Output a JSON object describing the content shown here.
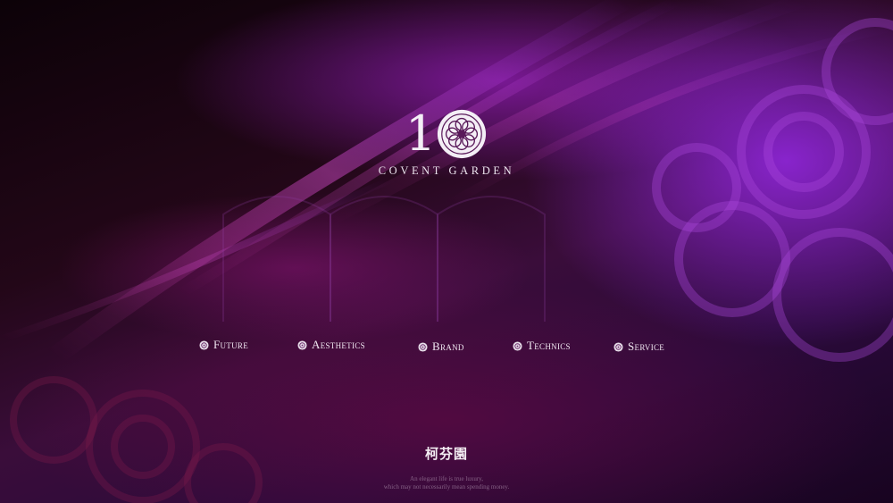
{
  "brand": {
    "logo_number": "1",
    "logo_text": "COVENT GARDEN"
  },
  "nav": {
    "items": [
      {
        "label": "Future",
        "icon": "rosette-icon"
      },
      {
        "label": "Aesthetics",
        "icon": "rosette-icon"
      },
      {
        "label": "Brand",
        "icon": "rosette-icon"
      },
      {
        "label": "Technics",
        "icon": "rosette-icon"
      },
      {
        "label": "Service",
        "icon": "rosette-icon"
      }
    ]
  },
  "footer": {
    "title": "柯芬園",
    "tagline_1": "An elegant life is true luxury,",
    "tagline_2": "which may not necessarily mean spending money."
  },
  "colors": {
    "accent_purple": "#9a2ee6",
    "deep_magenta": "#6a0e4a",
    "text_light": "#efe6f0"
  }
}
